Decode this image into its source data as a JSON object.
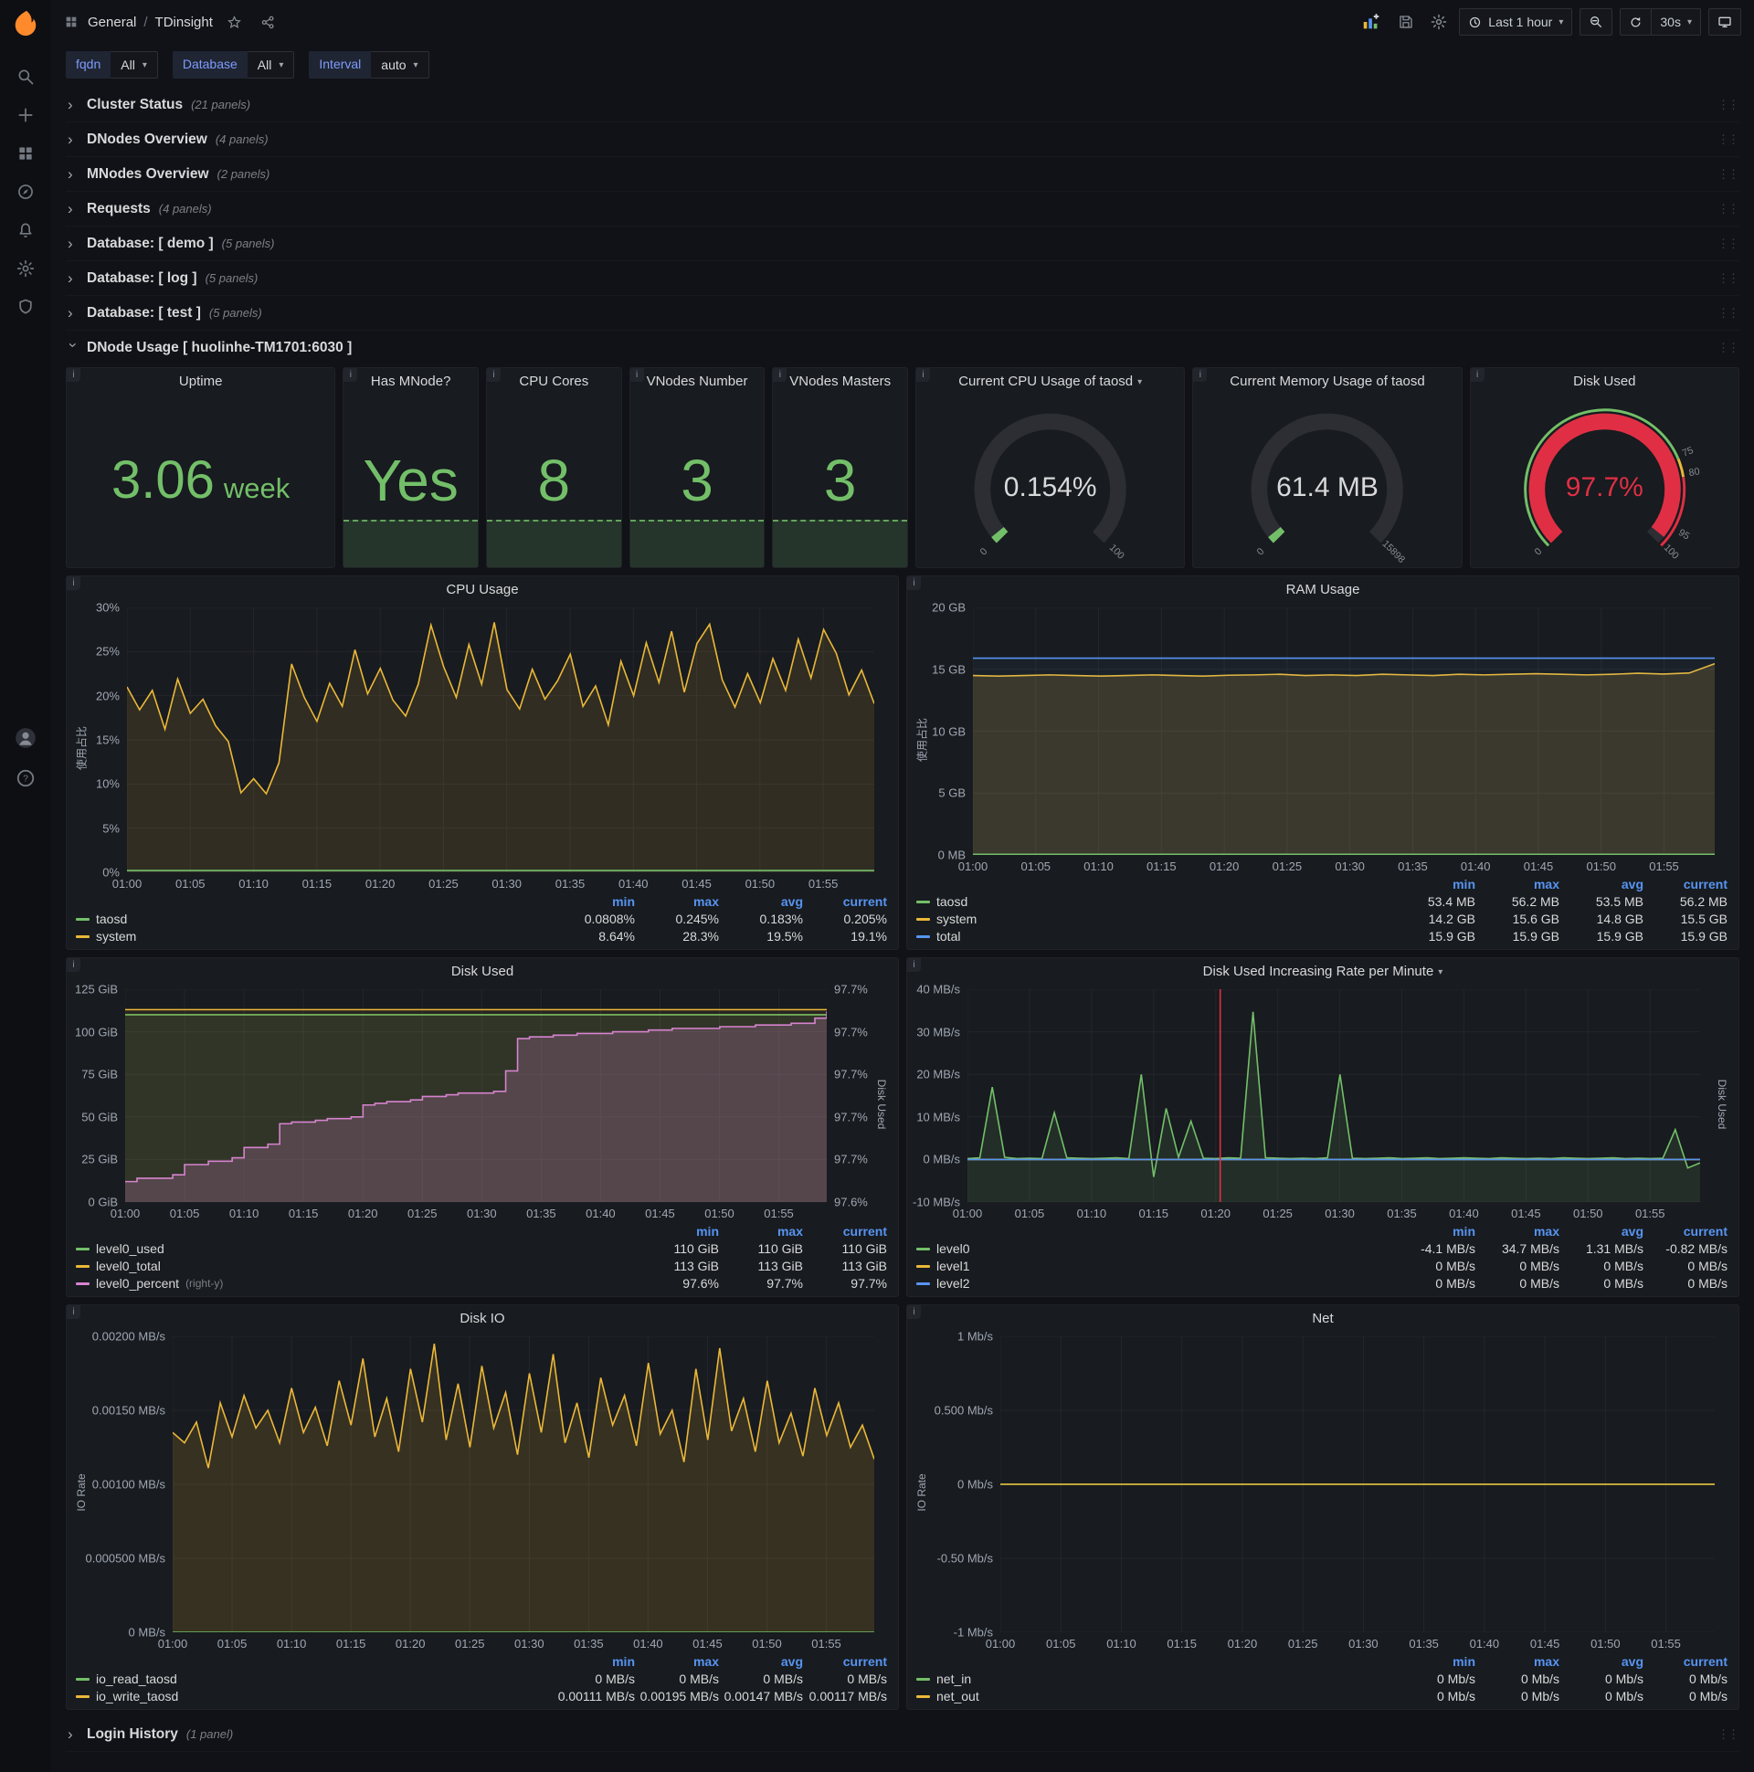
{
  "nav": {
    "breadcrumb_folder": "General",
    "breadcrumb_sep": "/",
    "breadcrumb_title": "TDinsight",
    "time_range": "Last 1 hour",
    "refresh": "30s"
  },
  "variables": [
    {
      "label": "fqdn",
      "value": "All"
    },
    {
      "label": "Database",
      "value": "All"
    },
    {
      "label": "Interval",
      "value": "auto"
    }
  ],
  "rows": [
    {
      "title": "Cluster Status",
      "count": "(21 panels)"
    },
    {
      "title": "DNodes Overview",
      "count": "(4 panels)"
    },
    {
      "title": "MNodes Overview",
      "count": "(2 panels)"
    },
    {
      "title": "Requests",
      "count": "(4 panels)"
    },
    {
      "title": "Database: [ demo ]",
      "count": "(5 panels)"
    },
    {
      "title": "Database: [ log ]",
      "count": "(5 panels)"
    },
    {
      "title": "Database: [ test ]",
      "count": "(5 panels)"
    }
  ],
  "dnode_row": {
    "title": "DNode Usage [ huolinhe-TM1701:6030 ]"
  },
  "login_row": {
    "title": "Login History",
    "count": "(1 panel)"
  },
  "stats": {
    "uptime": {
      "title": "Uptime",
      "value": "3.06",
      "unit": "week"
    },
    "has_mnode": {
      "title": "Has MNode?",
      "value": "Yes"
    },
    "cpu_cores": {
      "title": "CPU Cores",
      "value": "8"
    },
    "vnodes_number": {
      "title": "VNodes Number",
      "value": "3"
    },
    "vnodes_masters": {
      "title": "VNodes Masters",
      "value": "3"
    }
  },
  "gauges": {
    "cpu": {
      "title": "Current CPU Usage of taosd",
      "value": "0.154%",
      "frac": 0.00154,
      "color": "#73bf69",
      "value_color": "#d8d9da",
      "ticks": [
        {
          "label": "0",
          "frac": 0
        },
        {
          "label": "100",
          "frac": 1
        }
      ],
      "bands": []
    },
    "mem": {
      "title": "Current Memory Usage of taosd",
      "value": "61.4 MB",
      "frac": 0.0039,
      "color": "#73bf69",
      "value_color": "#d8d9da",
      "ticks": [
        {
          "label": "0",
          "frac": 0
        },
        {
          "label": "15898",
          "frac": 1
        }
      ],
      "bands": []
    },
    "disk": {
      "title": "Disk Used",
      "value": "97.7%",
      "frac": 0.977,
      "color": "#e02f44",
      "value_color": "#e02f44",
      "ticks": [
        {
          "label": "0",
          "frac": 0
        },
        {
          "label": "75",
          "frac": 0.75,
          "color": "#eab839"
        },
        {
          "label": "80",
          "frac": 0.8,
          "color": "#e02f44"
        },
        {
          "label": "95",
          "frac": 0.95
        },
        {
          "label": "100",
          "frac": 1
        }
      ],
      "bands": [
        {
          "from": 0,
          "to": 0.75,
          "color": "#73bf69"
        },
        {
          "from": 0.75,
          "to": 0.8,
          "color": "#eab839"
        },
        {
          "from": 0.8,
          "to": 1,
          "color": "#e02f44"
        }
      ]
    }
  },
  "charts": {
    "cpu": {
      "type": "line",
      "title": "CPU Usage",
      "ylabel": "使用占比",
      "ymin": 0,
      "ymax": 30,
      "gutter": 42,
      "yticks": [
        {
          "v": 30,
          "label": "30%"
        },
        {
          "v": 25,
          "label": "25%"
        },
        {
          "v": 20,
          "label": "20%"
        },
        {
          "v": 15,
          "label": "15%"
        },
        {
          "v": 10,
          "label": "10%"
        },
        {
          "v": 5,
          "label": "5%"
        },
        {
          "v": 0,
          "label": "0%"
        }
      ],
      "xticks": [
        "01:00",
        "01:05",
        "01:10",
        "01:15",
        "01:20",
        "01:25",
        "01:30",
        "01:35",
        "01:40",
        "01:45",
        "01:50",
        "01:55"
      ],
      "xstep": 0.0847,
      "legend_headers": [
        "min",
        "max",
        "avg",
        "current"
      ],
      "legend": [
        {
          "name": "taosd",
          "color": "#73bf69",
          "values": [
            "0.0808%",
            "0.245%",
            "0.183%",
            "0.205%"
          ]
        },
        {
          "name": "system",
          "color": "#eab839",
          "values": [
            "8.64%",
            "28.3%",
            "19.5%",
            "19.1%"
          ]
        }
      ],
      "series": [
        {
          "name": "system",
          "color": "#eab839",
          "fill": 0.12,
          "values": [
            21.0,
            18.4,
            20.6,
            16.2,
            21.9,
            18.0,
            19.6,
            16.6,
            14.8,
            9.0,
            10.6,
            8.9,
            12.4,
            23.6,
            19.8,
            17.1,
            21.4,
            18.8,
            25.2,
            20.2,
            23.1,
            19.5,
            17.7,
            21.3,
            28.0,
            23.3,
            19.8,
            25.8,
            21.3,
            28.3,
            20.7,
            18.5,
            23.0,
            19.6,
            21.7,
            24.7,
            18.8,
            21.1,
            16.7,
            23.9,
            20.0,
            26.0,
            21.5,
            27.3,
            20.4,
            25.9,
            28.1,
            21.8,
            18.7,
            22.5,
            19.2,
            24.2,
            20.6,
            26.4,
            22.0,
            27.5,
            24.8,
            20.1,
            22.9,
            19.1
          ]
        },
        {
          "name": "taosd",
          "color": "#73bf69",
          "fill": 0,
          "values": [
            0.2
          ]
        }
      ]
    },
    "ram": {
      "type": "line",
      "title": "RAM Usage",
      "ylabel": "使用占比",
      "ymin": 0,
      "ymax": 20,
      "gutter": 48,
      "yticks": [
        {
          "v": 20,
          "label": "20 GB"
        },
        {
          "v": 15,
          "label": "15 GB"
        },
        {
          "v": 10,
          "label": "10 GB"
        },
        {
          "v": 5,
          "label": "5 GB"
        },
        {
          "v": 0,
          "label": "0 MB"
        }
      ],
      "xticks": [
        "01:00",
        "01:05",
        "01:10",
        "01:15",
        "01:20",
        "01:25",
        "01:30",
        "01:35",
        "01:40",
        "01:45",
        "01:50",
        "01:55"
      ],
      "xstep": 0.0847,
      "legend_headers": [
        "min",
        "max",
        "avg",
        "current"
      ],
      "legend": [
        {
          "name": "taosd",
          "color": "#73bf69",
          "values": [
            "53.4 MB",
            "56.2 MB",
            "53.5 MB",
            "56.2 MB"
          ]
        },
        {
          "name": "system",
          "color": "#eab839",
          "values": [
            "14.2 GB",
            "15.6 GB",
            "14.8 GB",
            "15.5 GB"
          ]
        },
        {
          "name": "total",
          "color": "#5794f2",
          "values": [
            "15.9 GB",
            "15.9 GB",
            "15.9 GB",
            "15.9 GB"
          ]
        }
      ],
      "series": [
        {
          "name": "system",
          "color": "#eab839",
          "fill": 0.16,
          "values": [
            14.5,
            14.45,
            14.5,
            14.55,
            14.5,
            14.45,
            14.5,
            14.55,
            14.5,
            14.45,
            14.52,
            14.55,
            14.6,
            14.5,
            14.55,
            14.5,
            14.6,
            14.55,
            14.5,
            14.6,
            14.55,
            14.6,
            14.65,
            14.6,
            14.55,
            14.6,
            14.68,
            14.62,
            14.7,
            15.45
          ]
        },
        {
          "name": "total",
          "color": "#5794f2",
          "fill": 0.05,
          "values": [
            15.9
          ]
        },
        {
          "name": "taosd",
          "color": "#73bf69",
          "fill": 0,
          "values": [
            0.05
          ]
        }
      ]
    },
    "disk_used": {
      "type": "line",
      "title": "Disk Used",
      "ymin": 0,
      "ymax": 125,
      "gutter": 56,
      "gutter_right": 52,
      "ylabel_right": "Disk Used",
      "yticks": [
        {
          "v": 125,
          "label": "125 GiB"
        },
        {
          "v": 100,
          "label": "100 GiB"
        },
        {
          "v": 75,
          "label": "75 GiB"
        },
        {
          "v": 50,
          "label": "50 GiB"
        },
        {
          "v": 25,
          "label": "25 GiB"
        },
        {
          "v": 0,
          "label": "0 GiB"
        }
      ],
      "yticks_right": [
        "97.7%",
        "97.7%",
        "97.7%",
        "97.7%",
        "97.7%",
        "97.6%"
      ],
      "xticks": [
        "01:00",
        "01:05",
        "01:10",
        "01:15",
        "01:20",
        "01:25",
        "01:30",
        "01:35",
        "01:40",
        "01:45",
        "01:50",
        "01:55"
      ],
      "xstep": 0.0847,
      "legend_headers": [
        "min",
        "max",
        "current"
      ],
      "legend": [
        {
          "name": "level0_used",
          "color": "#73bf69",
          "values": [
            "110 GiB",
            "110 GiB",
            "110 GiB"
          ]
        },
        {
          "name": "level0_total",
          "color": "#eab839",
          "values": [
            "113 GiB",
            "113 GiB",
            "113 GiB"
          ]
        },
        {
          "name": "level0_percent",
          "suffix": "(right-y)",
          "color": "#d683ce",
          "values": [
            "97.6%",
            "97.7%",
            "97.7%"
          ]
        }
      ],
      "series": [
        {
          "name": "level0_used",
          "color": "#73bf69",
          "fill": 0.1,
          "values": [
            110
          ]
        },
        {
          "name": "level0_total",
          "color": "#eab839",
          "fill": 0.08,
          "values": [
            113
          ]
        },
        {
          "name": "level0_percent",
          "color": "#d683ce",
          "fill": 0.22,
          "step": true,
          "smin": 97.593,
          "smax": 97.718,
          "values": [
            97.605,
            97.607,
            97.607,
            97.607,
            97.609,
            97.615,
            97.615,
            97.617,
            97.617,
            97.619,
            97.625,
            97.625,
            97.627,
            97.639,
            97.64,
            97.64,
            97.641,
            97.642,
            97.642,
            97.643,
            97.65,
            97.651,
            97.652,
            97.652,
            97.653,
            97.655,
            97.655,
            97.656,
            97.657,
            97.657,
            97.657,
            97.658,
            97.67,
            97.689,
            97.69,
            97.69,
            97.691,
            97.691,
            97.692,
            97.692,
            97.692,
            97.693,
            97.693,
            97.693,
            97.694,
            97.694,
            97.695,
            97.695,
            97.695,
            97.695,
            97.696,
            97.696,
            97.696,
            97.697,
            97.697,
            97.697,
            97.698,
            97.698,
            97.701,
            97.705
          ]
        }
      ]
    },
    "disk_rate": {
      "type": "line",
      "title": "Disk Used Increasing Rate per Minute",
      "ymin": -10,
      "ymax": 40,
      "gutter": 58,
      "gutter_right": 16,
      "ylabel_right": "Disk Used",
      "yticks": [
        {
          "v": 40,
          "label": "40 MB/s"
        },
        {
          "v": 30,
          "label": "30 MB/s"
        },
        {
          "v": 20,
          "label": "20 MB/s"
        },
        {
          "v": 10,
          "label": "10 MB/s"
        },
        {
          "v": 0,
          "label": "0 MB/s"
        },
        {
          "v": -10,
          "label": "-10 MB/s"
        }
      ],
      "xticks": [
        "01:00",
        "01:05",
        "01:10",
        "01:15",
        "01:20",
        "01:25",
        "01:30",
        "01:35",
        "01:40",
        "01:45",
        "01:50",
        "01:55"
      ],
      "xstep": 0.0847,
      "annotations": [
        {
          "frac": 0.345,
          "color": "#e02f44"
        }
      ],
      "legend_headers": [
        "min",
        "max",
        "avg",
        "current"
      ],
      "legend": [
        {
          "name": "level0",
          "color": "#73bf69",
          "values": [
            "-4.1 MB/s",
            "34.7 MB/s",
            "1.31 MB/s",
            "-0.82 MB/s"
          ]
        },
        {
          "name": "level1",
          "color": "#eab839",
          "values": [
            "0 MB/s",
            "0 MB/s",
            "0 MB/s",
            "0 MB/s"
          ]
        },
        {
          "name": "level2",
          "color": "#5794f2",
          "values": [
            "0 MB/s",
            "0 MB/s",
            "0 MB/s",
            "0 MB/s"
          ]
        }
      ],
      "series": [
        {
          "name": "level0",
          "color": "#73bf69",
          "fill": 0.12,
          "values": [
            0.2,
            0.4,
            17,
            0.5,
            0.2,
            0.3,
            0.2,
            11,
            0.4,
            0.3,
            0.2,
            0.3,
            0.4,
            0.2,
            20,
            -4.1,
            12,
            0.5,
            9,
            0.3,
            0.2,
            0.4,
            0.3,
            34.7,
            0.4,
            0.3,
            0.2,
            0.3,
            0.2,
            0.4,
            20,
            0.3,
            0.2,
            0.3,
            0.4,
            0.2,
            0.3,
            0.4,
            0.2,
            0.3,
            0.4,
            0.3,
            0.2,
            0.4,
            0.3,
            0.2,
            0.3,
            0.2,
            0.4,
            0.3,
            0.2,
            0.3,
            0.4,
            0.2,
            0.3,
            0.2,
            0.3,
            7,
            -2,
            -0.8
          ]
        },
        {
          "name": "level1",
          "color": "#eab839",
          "fill": 0,
          "values": [
            0
          ]
        },
        {
          "name": "level2",
          "color": "#5794f2",
          "fill": 0,
          "values": [
            0
          ]
        }
      ]
    },
    "disk_io": {
      "type": "line",
      "title": "Disk IO",
      "ylabel": "IO Rate",
      "ymin": 0,
      "ymax": 0.002,
      "gutter": 92,
      "yticks": [
        {
          "v": 0.002,
          "label": "0.00200 MB/s"
        },
        {
          "v": 0.0015,
          "label": "0.00150 MB/s"
        },
        {
          "v": 0.001,
          "label": "0.00100 MB/s"
        },
        {
          "v": 0.0005,
          "label": "0.000500 MB/s"
        },
        {
          "v": 0,
          "label": "0 MB/s"
        }
      ],
      "xticks": [
        "01:00",
        "01:05",
        "01:10",
        "01:15",
        "01:20",
        "01:25",
        "01:30",
        "01:35",
        "01:40",
        "01:45",
        "01:50",
        "01:55"
      ],
      "xstep": 0.0847,
      "legend_headers": [
        "min",
        "max",
        "avg",
        "current"
      ],
      "legend": [
        {
          "name": "io_read_taosd",
          "color": "#73bf69",
          "values": [
            "0 MB/s",
            "0 MB/s",
            "0 MB/s",
            "0 MB/s"
          ]
        },
        {
          "name": "io_write_taosd",
          "color": "#eab839",
          "values": [
            "0.00111 MB/s",
            "0.00195 MB/s",
            "0.00147 MB/s",
            "0.00117 MB/s"
          ]
        }
      ],
      "series": [
        {
          "name": "io_write_taosd",
          "color": "#eab839",
          "fill": 0.15,
          "values": [
            0.00135,
            0.00128,
            0.00142,
            0.00111,
            0.00155,
            0.00132,
            0.0016,
            0.00138,
            0.0015,
            0.00128,
            0.00165,
            0.00135,
            0.00152,
            0.00126,
            0.0017,
            0.0014,
            0.00185,
            0.00132,
            0.00158,
            0.00122,
            0.00178,
            0.00142,
            0.00195,
            0.0013,
            0.00168,
            0.00125,
            0.0018,
            0.00138,
            0.00162,
            0.0012,
            0.00175,
            0.00135,
            0.00188,
            0.00128,
            0.00155,
            0.00118,
            0.00172,
            0.0014,
            0.0016,
            0.00126,
            0.00182,
            0.00134,
            0.0015,
            0.00115,
            0.00178,
            0.0013,
            0.00192,
            0.00136,
            0.00158,
            0.00122,
            0.0017,
            0.00128,
            0.00148,
            0.00119,
            0.00165,
            0.00133,
            0.00155,
            0.00125,
            0.0014,
            0.00117
          ]
        },
        {
          "name": "io_read_taosd",
          "color": "#73bf69",
          "fill": 0,
          "values": [
            0
          ]
        }
      ]
    },
    "net": {
      "type": "line",
      "title": "Net",
      "ylabel": "IO Rate",
      "ymin": -1,
      "ymax": 1,
      "gutter": 78,
      "yticks": [
        {
          "v": 1,
          "label": "1 Mb/s"
        },
        {
          "v": 0.5,
          "label": "0.500 Mb/s"
        },
        {
          "v": 0,
          "label": "0 Mb/s"
        },
        {
          "v": -0.5,
          "label": "-0.50 Mb/s"
        },
        {
          "v": -1,
          "label": "-1 Mb/s"
        }
      ],
      "xticks": [
        "01:00",
        "01:05",
        "01:10",
        "01:15",
        "01:20",
        "01:25",
        "01:30",
        "01:35",
        "01:40",
        "01:45",
        "01:50",
        "01:55"
      ],
      "xstep": 0.0847,
      "legend_headers": [
        "min",
        "max",
        "avg",
        "current"
      ],
      "legend": [
        {
          "name": "net_in",
          "color": "#73bf69",
          "values": [
            "0 Mb/s",
            "0 Mb/s",
            "0 Mb/s",
            "0 Mb/s"
          ]
        },
        {
          "name": "net_out",
          "color": "#eab839",
          "values": [
            "0 Mb/s",
            "0 Mb/s",
            "0 Mb/s",
            "0 Mb/s"
          ]
        }
      ],
      "series": [
        {
          "name": "net_in",
          "color": "#73bf69",
          "fill": 0,
          "values": [
            0
          ]
        },
        {
          "name": "net_out",
          "color": "#eab839",
          "fill": 0,
          "values": [
            0
          ]
        }
      ]
    }
  }
}
